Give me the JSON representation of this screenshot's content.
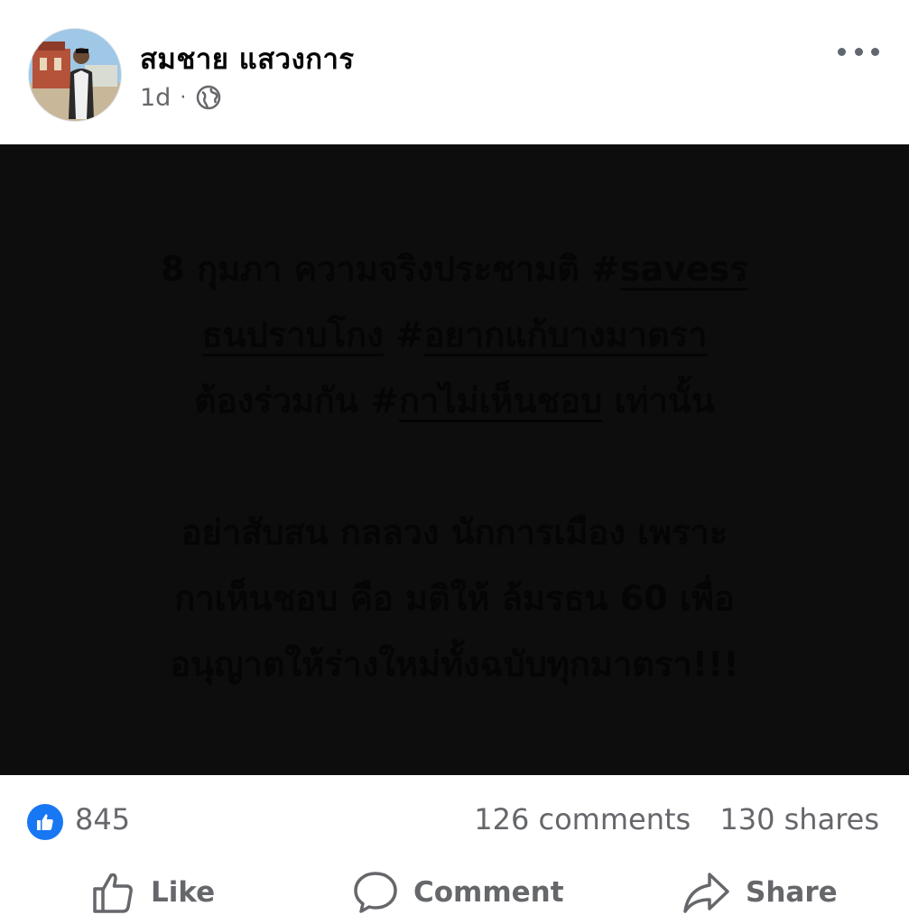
{
  "post": {
    "author": "สมชาย แสวงการ",
    "time": "1d",
    "separator": "·",
    "audience_icon": "globe-icon",
    "more_icon": "more-horizontal-icon",
    "card": {
      "line1_pre": "8 กุมภา ความจริงประชามติ  #",
      "line1_tag": "savesร",
      "line2_tag_cont": "ธนปราบโกง",
      "line2_mid": "  #",
      "line2_tag": "อยากแก้บางมาตรา",
      "line3_pre": "ต้องร่วมกัน #",
      "line3_tag": "กาไม่เห็นชอบ",
      "line3_post": " เท่านั้น",
      "line4": "อย่าสับสน กลลวง นักการเมือง เพราะ",
      "line5": "กาเห็นชอบ คือ มติให้ ล้มรธน 60 เพื่อ",
      "line6": "อนุญาตให้ร่างใหม่ทั้งฉบับทุกมาตรา!!!"
    }
  },
  "stats": {
    "likes": "845",
    "comments": "126 comments",
    "shares": "130 shares"
  },
  "actions": {
    "like": "Like",
    "comment": "Comment",
    "share": "Share"
  },
  "colors": {
    "accent": "#1877f2",
    "card_bg": "#0d0d0d",
    "secondary_text": "#65676b"
  }
}
